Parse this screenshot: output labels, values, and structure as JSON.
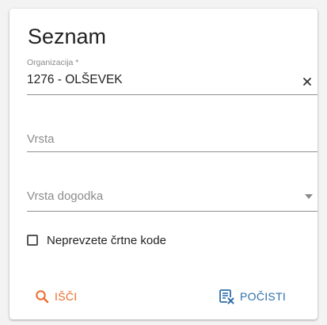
{
  "title": "Seznam",
  "organizacija": {
    "label": "Organizacija *",
    "value": "1276 - OLŠEVEK",
    "clear_icon": "close-icon"
  },
  "vrsta": {
    "placeholder": "Vrsta"
  },
  "vrsta_dogodka": {
    "placeholder": "Vrsta dogodka",
    "dropdown_icon": "arrow-drop-down-icon"
  },
  "checkbox": {
    "label": "Neprevzete črtne kode",
    "checked": false
  },
  "buttons": {
    "search_label": "IŠČI",
    "search_icon": "search-icon",
    "clear_label": "POČISTI",
    "clear_icon": "clear-list-icon"
  },
  "colors": {
    "search_accent": "#e96b2c",
    "clear_accent": "#2f6fa8"
  }
}
